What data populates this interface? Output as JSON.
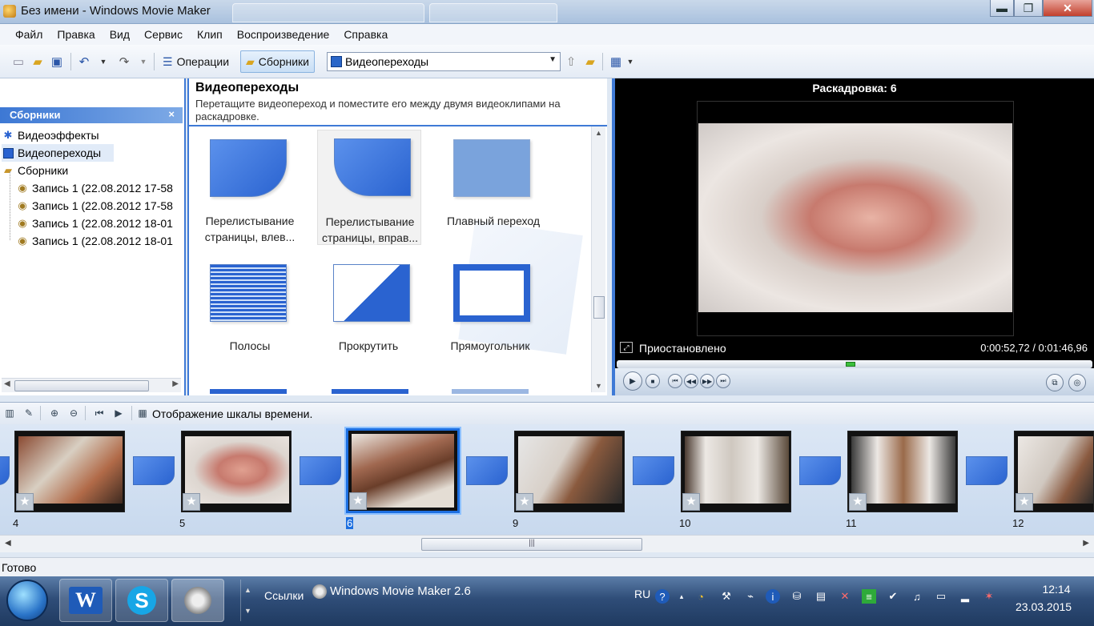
{
  "window": {
    "title": "Без имени - Windows Movie Maker",
    "minimize": "▬",
    "maximize": "❐",
    "close": "✕"
  },
  "menu": [
    "Файл",
    "Правка",
    "Вид",
    "Сервис",
    "Клип",
    "Воспроизведение",
    "Справка"
  ],
  "toolbar": {
    "tasks_label": "Операции",
    "collections_label": "Сборники",
    "combo_value": "Видеопереходы"
  },
  "left_pane": {
    "header": "Сборники",
    "close": "×",
    "items": [
      {
        "label": "Видеоэффекты",
        "icon": "star-icon"
      },
      {
        "label": "Видеопереходы",
        "icon": "transition-icon"
      },
      {
        "label": "Сборники",
        "icon": "folder-icon"
      },
      {
        "label": "Запись 1 (22.08.2012 17-58",
        "icon": "collection-icon"
      },
      {
        "label": "Запись 1 (22.08.2012 17-58",
        "icon": "collection-icon"
      },
      {
        "label": "Запись 1 (22.08.2012 18-01",
        "icon": "collection-icon"
      },
      {
        "label": "Запись 1 (22.08.2012 18-01",
        "icon": "collection-icon"
      }
    ]
  },
  "center_pane": {
    "title": "Видеопереходы",
    "description": "Перетащите видеопереход и поместите его между двумя видеоклипами на раскадровке.",
    "transitions": [
      {
        "label": "Перелистывание страницы, влев..."
      },
      {
        "label": "Перелистывание страницы, вправ..."
      },
      {
        "label": "Плавный переход"
      },
      {
        "label": "Полосы"
      },
      {
        "label": "Прокрутить"
      },
      {
        "label": "Прямоугольник"
      }
    ]
  },
  "preview": {
    "title": "Раскадровка: 6",
    "status": "Приостановлено",
    "time": "0:00:52,72 / 0:01:46,96"
  },
  "timeline": {
    "label": "Отображение шкалы времени.",
    "clips": [
      {
        "number": "4"
      },
      {
        "number": "5"
      },
      {
        "number": "6",
        "selected": true
      },
      {
        "number": "9"
      },
      {
        "number": "10"
      },
      {
        "number": "11"
      },
      {
        "number": "12"
      }
    ]
  },
  "statusbar": {
    "text": "Готово"
  },
  "taskbar": {
    "links": "Ссылки",
    "app": "Windows Movie Maker 2.6",
    "lang": "RU",
    "time": "12:14",
    "date": "23.03.2015"
  },
  "colors": {
    "accent": "#3f7ad6",
    "transition": "#2a63d0"
  }
}
